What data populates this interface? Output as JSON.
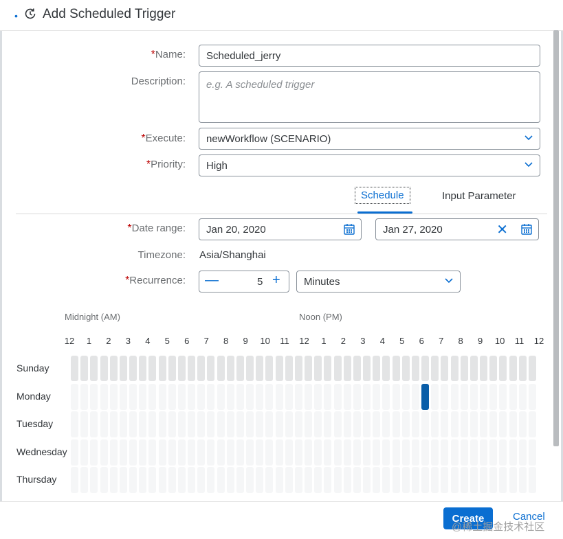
{
  "dialog": {
    "title": "Add Scheduled Trigger"
  },
  "form": {
    "required_mark": "*",
    "name_label": "Name:",
    "name_value": "Scheduled_jerry",
    "description_label": "Description:",
    "description_placeholder": "e.g.  A scheduled trigger",
    "execute_label": "Execute:",
    "execute_value": "newWorkflow (SCENARIO)",
    "priority_label": "Priority:",
    "priority_value": "High"
  },
  "tabs": [
    {
      "label": "Schedule",
      "active": true
    },
    {
      "label": "Input Parameter",
      "active": false
    }
  ],
  "schedule": {
    "date_range_label": "Date range:",
    "start_date": "Jan 20, 2020",
    "end_date": "Jan 27, 2020",
    "timezone_label": "Timezone:",
    "timezone_value": "Asia/Shanghai",
    "recurrence_label": "Recurrence:",
    "recurrence_value": "5",
    "recurrence_unit": "Minutes",
    "midnight_label": "Midnight (AM)",
    "noon_label": "Noon (PM)",
    "hours": [
      "12",
      "1",
      "2",
      "3",
      "4",
      "5",
      "6",
      "7",
      "8",
      "9",
      "10",
      "11",
      "12",
      "1",
      "2",
      "3",
      "4",
      "5",
      "6",
      "7",
      "8",
      "9",
      "10",
      "11",
      "12"
    ],
    "days": [
      "Sunday",
      "Monday",
      "Tuesday",
      "Wednesday",
      "Thursday"
    ],
    "selected_slot": {
      "day": "Monday",
      "hour": "6 PM"
    }
  },
  "footer": {
    "create_label": "Create",
    "cancel_label": "Cancel"
  },
  "watermark": "@稀土掘金技术社区",
  "colors": {
    "accent": "#0a6ed1",
    "required": "#bb0000",
    "selected_cell": "#0a5ea8"
  }
}
